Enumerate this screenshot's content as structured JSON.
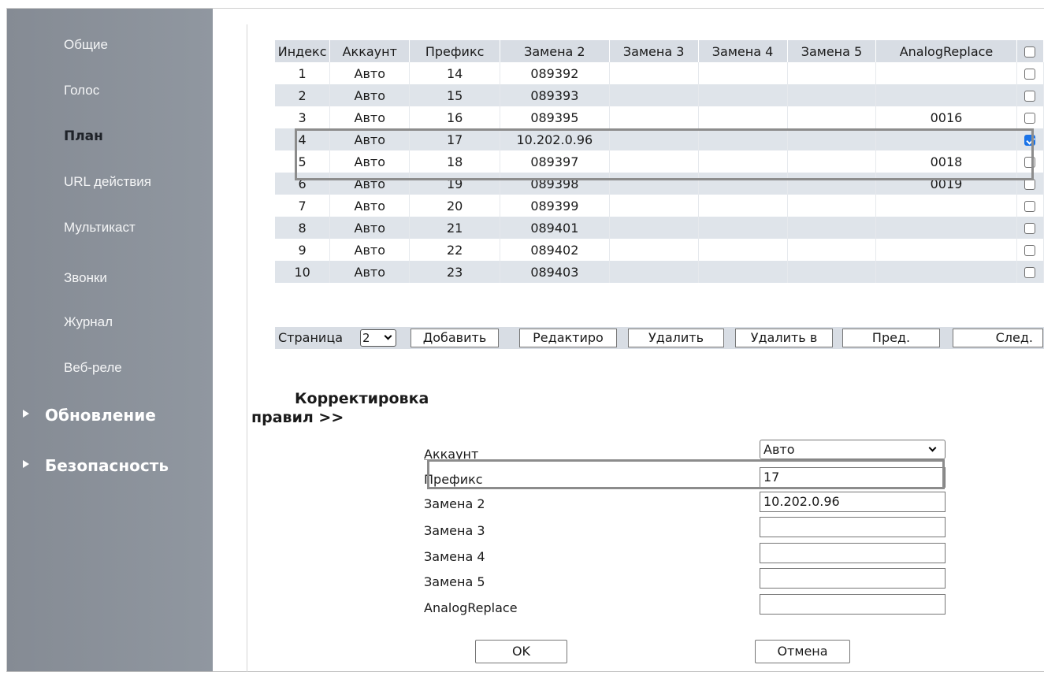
{
  "sidebar": {
    "items": [
      {
        "label": "Общие"
      },
      {
        "label": "Голос"
      },
      {
        "label": "План"
      },
      {
        "label": "URL действия"
      },
      {
        "label": "Мультикаст"
      },
      {
        "label": "Звонки"
      },
      {
        "label": "Журнал"
      },
      {
        "label": "Веб-реле"
      }
    ],
    "groups": [
      {
        "label": "Обновление"
      },
      {
        "label": "Безопасность"
      }
    ],
    "active_item": "План"
  },
  "table": {
    "headers": [
      "Индекс",
      "Аккаунт",
      "Префикс",
      "Замена 2",
      "Замена 3",
      "Замена 4",
      "Замена 5",
      "AnalogReplace"
    ],
    "rows": [
      {
        "index": "1",
        "account": "Авто",
        "prefix": "14",
        "r2": "089392",
        "r3": "",
        "r4": "",
        "r5": "",
        "analog": "",
        "checked": false
      },
      {
        "index": "2",
        "account": "Авто",
        "prefix": "15",
        "r2": "089393",
        "r3": "",
        "r4": "",
        "r5": "",
        "analog": "",
        "checked": false
      },
      {
        "index": "3",
        "account": "Авто",
        "prefix": "16",
        "r2": "089395",
        "r3": "",
        "r4": "",
        "r5": "",
        "analog": "0016",
        "checked": false
      },
      {
        "index": "4",
        "account": "Авто",
        "prefix": "17",
        "r2": "10.202.0.96",
        "r3": "",
        "r4": "",
        "r5": "",
        "analog": "",
        "checked": true
      },
      {
        "index": "5",
        "account": "Авто",
        "prefix": "18",
        "r2": "089397",
        "r3": "",
        "r4": "",
        "r5": "",
        "analog": "0018",
        "checked": false
      },
      {
        "index": "6",
        "account": "Авто",
        "prefix": "19",
        "r2": "089398",
        "r3": "",
        "r4": "",
        "r5": "",
        "analog": "0019",
        "checked": false
      },
      {
        "index": "7",
        "account": "Авто",
        "prefix": "20",
        "r2": "089399",
        "r3": "",
        "r4": "",
        "r5": "",
        "analog": "",
        "checked": false
      },
      {
        "index": "8",
        "account": "Авто",
        "prefix": "21",
        "r2": "089401",
        "r3": "",
        "r4": "",
        "r5": "",
        "analog": "",
        "checked": false
      },
      {
        "index": "9",
        "account": "Авто",
        "prefix": "22",
        "r2": "089402",
        "r3": "",
        "r4": "",
        "r5": "",
        "analog": "",
        "checked": false
      },
      {
        "index": "10",
        "account": "Авто",
        "prefix": "23",
        "r2": "089403",
        "r3": "",
        "r4": "",
        "r5": "",
        "analog": "",
        "checked": false
      }
    ]
  },
  "pager": {
    "label": "Страница",
    "page_value": "2",
    "buttons": {
      "add": "Добавить",
      "edit": "Редактиро",
      "delete": "Удалить",
      "delete_all": "Удалить в",
      "prev": "Пред.",
      "next": "След."
    }
  },
  "form": {
    "title_line1": "Корректировка",
    "title_line2": "правил >>",
    "fields": {
      "account": {
        "label": "Аккаунт",
        "value": "Авто"
      },
      "prefix": {
        "label": "Префикс",
        "value": "17"
      },
      "r2": {
        "label": "Замена 2",
        "value": "10.202.0.96"
      },
      "r3": {
        "label": "Замена 3",
        "value": ""
      },
      "r4": {
        "label": "Замена 4",
        "value": ""
      },
      "r5": {
        "label": "Замена 5",
        "value": ""
      },
      "analog": {
        "label": "AnalogReplace",
        "value": ""
      }
    },
    "ok_label": "OK",
    "cancel_label": "Отмена"
  },
  "colors": {
    "sidebar_bg": "#8a9099",
    "header_bg": "#d8dde4",
    "row_alt_bg": "#dfe4ea",
    "checkbox_checked": "#1a73e8",
    "highlight_frame": "#8c8c8c"
  }
}
